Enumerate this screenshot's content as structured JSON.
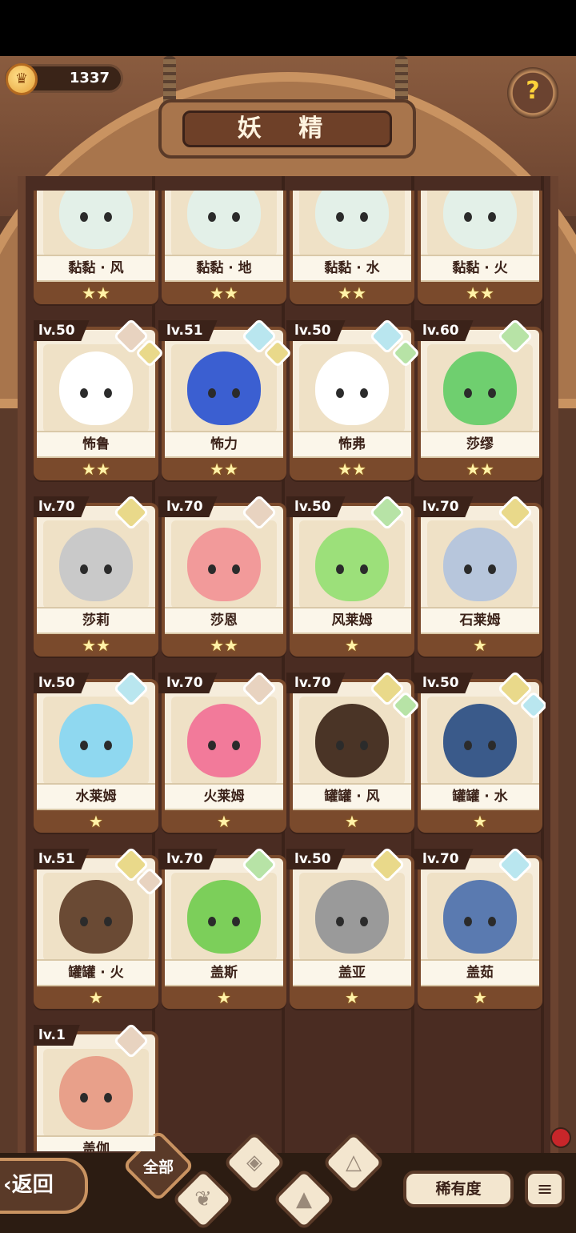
{
  "header": {
    "coins": "1337",
    "coin_icon": "crown-coin-icon",
    "title": "妖 精",
    "help_icon": "question-sprout-icon"
  },
  "colors": {
    "fire": "#e8d3c0",
    "earth": "#e9d98a",
    "water": "#b9e6ef",
    "wind": "#b7e3a6"
  },
  "cards": [
    {
      "name": "黏黏 · 风",
      "level": "",
      "stars": "★★",
      "elements": []
    },
    {
      "name": "黏黏 · 地",
      "level": "",
      "stars": "★★",
      "elements": []
    },
    {
      "name": "黏黏 · 水",
      "level": "",
      "stars": "★★",
      "elements": []
    },
    {
      "name": "黏黏 · 火",
      "level": "",
      "stars": "★★",
      "elements": []
    },
    {
      "name": "怖鲁",
      "level": "lv.50",
      "stars": "★★",
      "elements": [
        "fire",
        "earth"
      ]
    },
    {
      "name": "怖力",
      "level": "lv.51",
      "stars": "★★",
      "elements": [
        "water",
        "earth"
      ]
    },
    {
      "name": "怖弗",
      "level": "lv.50",
      "stars": "★★",
      "elements": [
        "water",
        "wind"
      ]
    },
    {
      "name": "莎缪",
      "level": "lv.60",
      "stars": "★★",
      "elements": [
        "wind"
      ]
    },
    {
      "name": "莎莉",
      "level": "lv.70",
      "stars": "★★",
      "elements": [
        "earth"
      ]
    },
    {
      "name": "莎恩",
      "level": "lv.70",
      "stars": "★★",
      "elements": [
        "fire"
      ]
    },
    {
      "name": "风莱姆",
      "level": "lv.50",
      "stars": "★",
      "elements": [
        "wind"
      ]
    },
    {
      "name": "石莱姆",
      "level": "lv.70",
      "stars": "★",
      "elements": [
        "earth"
      ]
    },
    {
      "name": "水莱姆",
      "level": "lv.50",
      "stars": "★",
      "elements": [
        "water"
      ]
    },
    {
      "name": "火莱姆",
      "level": "lv.70",
      "stars": "★",
      "elements": [
        "fire"
      ]
    },
    {
      "name": "罐罐 · 风",
      "level": "lv.70",
      "stars": "★",
      "elements": [
        "earth",
        "wind"
      ]
    },
    {
      "name": "罐罐 · 水",
      "level": "lv.50",
      "stars": "★",
      "elements": [
        "earth",
        "water"
      ]
    },
    {
      "name": "罐罐 · 火",
      "level": "lv.51",
      "stars": "★",
      "elements": [
        "earth",
        "fire"
      ]
    },
    {
      "name": "盖斯",
      "level": "lv.70",
      "stars": "★",
      "elements": [
        "wind"
      ]
    },
    {
      "name": "盖亚",
      "level": "lv.50",
      "stars": "★",
      "elements": [
        "earth"
      ]
    },
    {
      "name": "盖茹",
      "level": "lv.70",
      "stars": "★",
      "elements": [
        "water"
      ]
    },
    {
      "name": "盖伽",
      "level": "lv.1",
      "stars": "★",
      "elements": [
        "fire"
      ]
    }
  ],
  "bottom": {
    "back_label": "‹返回",
    "filter_all": "全部",
    "filter_icons": [
      "sprout-icon",
      "droplet-icon",
      "mountain-icon",
      "volcano-icon"
    ],
    "rarity_label": "稀有度",
    "sort_icon": "sort-list-icon"
  }
}
